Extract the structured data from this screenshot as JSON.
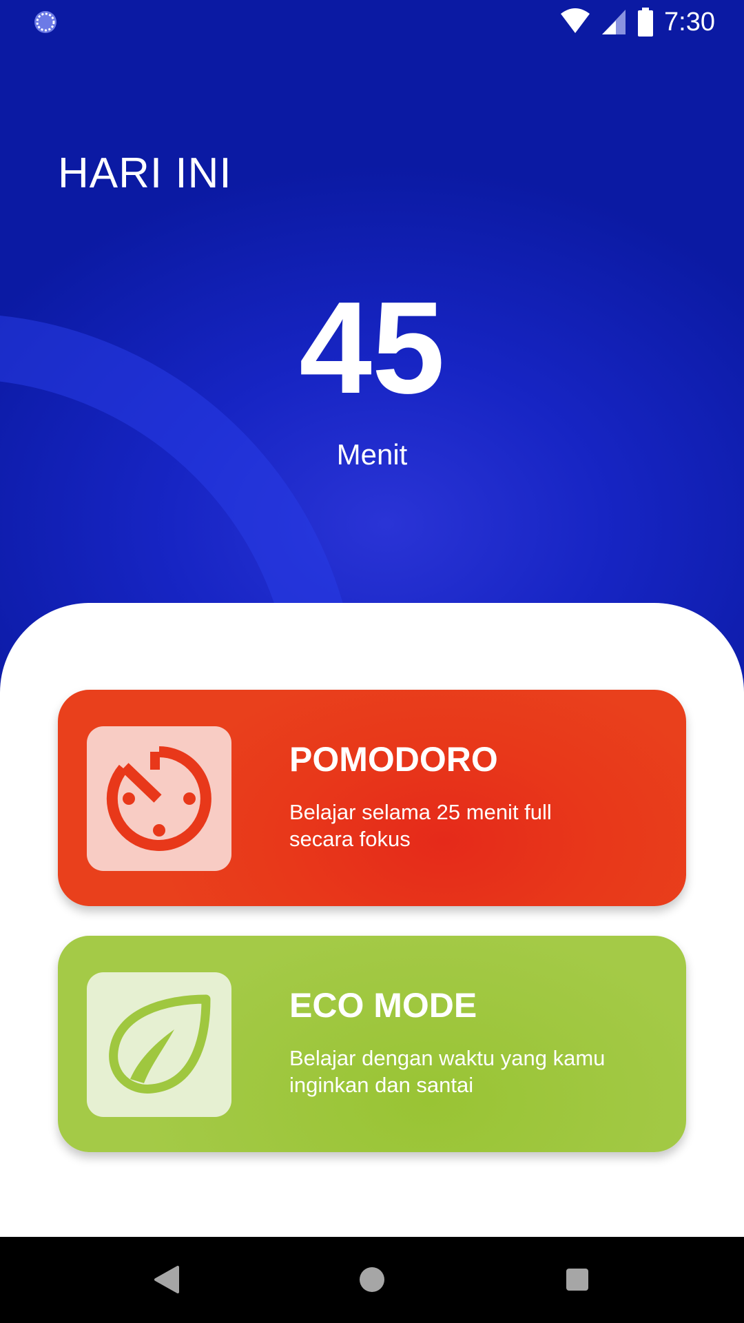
{
  "status_bar": {
    "time": "7:30",
    "left_icon": "loading-circle-icon",
    "right_icons": [
      "wifi-icon",
      "signal-icon",
      "battery-icon"
    ]
  },
  "header": {
    "title": "HARI INI",
    "minutes_value": "45",
    "minutes_label": "Menit"
  },
  "modes": [
    {
      "title": "POMODORO",
      "description": "Belajar selama 25 menit full secara fokus",
      "icon": "timer-icon",
      "color": "#e8381a"
    },
    {
      "title": "ECO MODE",
      "description": "Belajar dengan waktu yang kamu inginkan dan santai",
      "icon": "leaf-icon",
      "color": "#9fc73f"
    }
  ],
  "nav_bar": {
    "icons": [
      "back-triangle-icon",
      "home-circle-icon",
      "recents-square-icon"
    ]
  },
  "colors": {
    "header_blue": "#1725c4",
    "sheet_white": "#ffffff",
    "nav_black": "#000000"
  }
}
